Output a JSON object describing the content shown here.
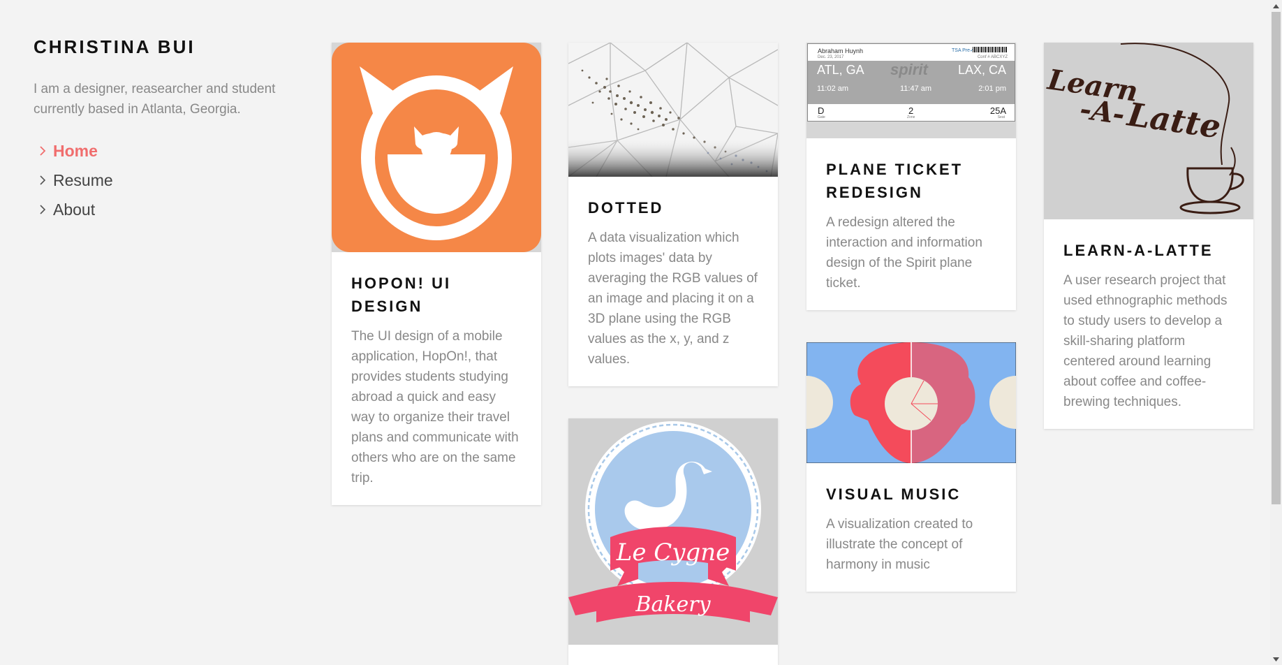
{
  "site": {
    "name": "CHRISTINA BUI",
    "bio": "I am a designer, reasearcher and student currently based in Atlanta, Georgia."
  },
  "nav": {
    "items": [
      {
        "label": "Home",
        "active": true
      },
      {
        "label": "Resume",
        "active": false
      },
      {
        "label": "About",
        "active": false
      }
    ]
  },
  "projects": [
    {
      "title": "HOPON! UI DESIGN",
      "description": "The UI design of a mobile application, HopOn!, that provides students studying abroad a quick and easy way to organize their travel plans and communicate with others who are on the same trip."
    },
    {
      "title": "DOTTED",
      "description": "A data visualization which plots images' data by averaging the RGB values of an image and placing it on a 3D plane using the RGB values as the x, y, and z values."
    },
    {
      "title": "PLANE TICKET REDESIGN",
      "description": "A redesign altered the interaction and information design of the Spirit plane ticket."
    },
    {
      "title": "LEARN-A-LATTE",
      "description": "A user research project that used ethnographic methods to study users to develop a skill-sharing platform centered around learning about coffee and coffee-brewing techniques."
    },
    {
      "title": "VISUAL MUSIC",
      "description": "A visualization created to illustrate the concept of harmony in music"
    }
  ],
  "ticket": {
    "passenger": "Abraham Huynh",
    "date": "Dec. 23, 2017",
    "tsa": "TSA Pre✓",
    "confirmation": "Conf # ABCXYZ",
    "from": "ATL, GA",
    "to": "LAX, CA",
    "airline": "spirit",
    "depart_time": "11:02 am",
    "board_time": "11:47 am",
    "arrive_time": "2:01 pm",
    "gate": "D",
    "gate_label": "Gate",
    "zone": "2",
    "zone_label": "Zone",
    "seat": "25A",
    "seat_label": "Seat"
  },
  "artwork_text": {
    "latte_line1": "Learn",
    "latte_line2": "-A-",
    "latte_line3": "Latte",
    "bakery_line1": "Le Cygne",
    "bakery_line2": "Bakery"
  },
  "colors": {
    "accent": "#f06d6d",
    "hopon_orange": "#f58747",
    "ticket_gray": "#a8a8a8",
    "music_blue": "#82b4f0",
    "music_red": "#f44b5b",
    "bakery_pink": "#f0456a"
  }
}
